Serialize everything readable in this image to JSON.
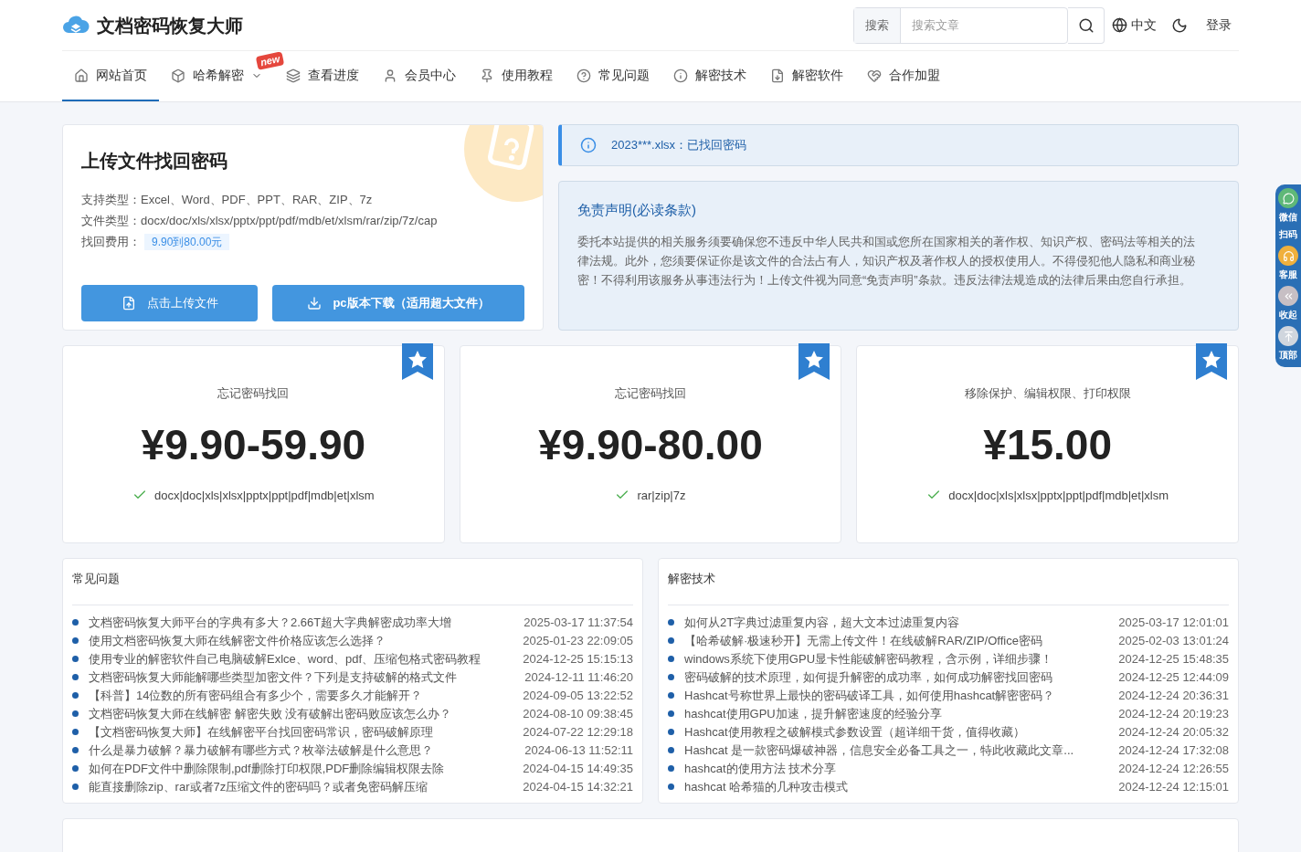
{
  "header": {
    "logo_text": "文档密码恢复大师",
    "search": {
      "button": "搜索",
      "placeholder": "搜索文章"
    },
    "language": "中文",
    "login": "登录"
  },
  "nav": [
    {
      "label": "网站首页",
      "selected": true
    },
    {
      "label": "哈希解密",
      "selected": false,
      "badge": "new",
      "dropdown": true
    },
    {
      "label": "查看进度",
      "selected": false
    },
    {
      "label": "会员中心",
      "selected": false
    },
    {
      "label": "使用教程",
      "selected": false
    },
    {
      "label": "常见问题",
      "selected": false
    },
    {
      "label": "解密技术",
      "selected": false
    },
    {
      "label": "解密软件",
      "selected": false
    },
    {
      "label": "合作加盟",
      "selected": false
    }
  ],
  "upload_card": {
    "title": "上传文件找回密码",
    "rows": [
      {
        "label": "支持类型：",
        "value": "Excel、Word、PDF、PPT、RAR、ZIP、7z"
      },
      {
        "label": "文件类型：",
        "value": "docx/doc/xls/xlsx/pptx/ppt/pdf/mdb/et/xlsm/rar/zip/7z/cap"
      }
    ],
    "fee": {
      "label": "找回费用：",
      "value": "9.90到80.00元"
    },
    "buttons": [
      {
        "label": "点击上传文件"
      },
      {
        "label": "pc版本下载（适用超大文件）"
      }
    ]
  },
  "notice": "2023***.xlsx：已找回密码",
  "disclaimer": {
    "title": "免责声明(必读条款)",
    "body": "委托本站提供的相关服务须要确保您不违反中华人民共和国或您所在国家相关的著作权、知识产权、密码法等相关的法律法规。此外，您须要保证你是该文件的合法占有人，知识产权及著作权人的授权使用人。不得侵犯他人隐私和商业秘密！不得利用该服务从事违法行为！上传文件视为同意“免责声明”条款。违反法律法规造成的法律后果由您自行承担。"
  },
  "price_cards": [
    {
      "subtitle": "忘记密码找回",
      "price": "¥9.90-59.90",
      "formats": "docx|doc|xls|xlsx|pptx|ppt|pdf|mdb|et|xlsm"
    },
    {
      "subtitle": "忘记密码找回",
      "price": "¥9.90-80.00",
      "formats": "rar|zip|7z"
    },
    {
      "subtitle": "移除保护、编辑权限、打印权限",
      "price": "¥15.00",
      "formats": "docx|doc|xls|xlsx|pptx|ppt|pdf|mdb|et|xlsm"
    }
  ],
  "lists": [
    {
      "title": "常见问题",
      "items": [
        {
          "title": "文档密码恢复大师平台的字典有多大？2.66T超大字典解密成功率大增",
          "date": "2025-03-17 11:37:54"
        },
        {
          "title": "使用文档密码恢复大师在线解密文件价格应该怎么选择？",
          "date": "2025-01-23 22:09:05"
        },
        {
          "title": "使用专业的解密软件自己电脑破解Exlce、word、pdf、压缩包格式密码教程",
          "date": "2024-12-25 15:15:13"
        },
        {
          "title": "文档密码恢复大师能解哪些类型加密文件？下列是支持破解的格式文件",
          "date": "2024-12-11 11:46:20"
        },
        {
          "title": "【科普】14位数的所有密码组合有多少个，需要多久才能解开？",
          "date": "2024-09-05 13:22:52"
        },
        {
          "title": "文档密码恢复大师在线解密 解密失败 没有破解出密码败应该怎么办？",
          "date": "2024-08-10 09:38:45"
        },
        {
          "title": "【文档密码恢复大师】在线解密平台找回密码常识，密码破解原理",
          "date": "2024-07-22 12:29:18"
        },
        {
          "title": "什么是暴力破解？暴力破解有哪些方式？枚举法破解是什么意思？",
          "date": "2024-06-13 11:52:11"
        },
        {
          "title": "如何在PDF文件中删除限制,pdf删除打印权限,PDF删除编辑权限去除",
          "date": "2024-04-15 14:49:35"
        },
        {
          "title": "能直接删除zip、rar或者7z压缩文件的密码吗？或者免密码解压缩",
          "date": "2024-04-15 14:32:21"
        }
      ]
    },
    {
      "title": "解密技术",
      "items": [
        {
          "title": "如何从2T字典过滤重复内容，超大文本过滤重复内容",
          "date": "2025-03-17 12:01:01"
        },
        {
          "title": "【哈希破解·极速秒开】无需上传文件！在线破解RAR/ZIP/Office密码",
          "date": "2025-02-03 13:01:24"
        },
        {
          "title": "windows系统下使用GPU显卡性能破解密码教程，含示例，详细步骤！",
          "date": "2024-12-25 15:48:35"
        },
        {
          "title": "密码破解的技术原理，如何提升解密的成功率，如何成功解密找回密码",
          "date": "2024-12-25 12:44:09"
        },
        {
          "title": "Hashcat号称世界上最快的密码破译工具，如何使用hashcat解密密码？",
          "date": "2024-12-24 20:36:31"
        },
        {
          "title": "hashcat使用GPU加速，提升解密速度的经验分享",
          "date": "2024-12-24 20:19:23"
        },
        {
          "title": "Hashcat使用教程之破解模式参数设置（超详细干货，值得收藏）",
          "date": "2024-12-24 20:05:32"
        },
        {
          "title": "Hashcat 是一款密码爆破神器，信息安全必备工具之一，特此收藏此文章...",
          "date": "2024-12-24 17:32:08"
        },
        {
          "title": "hashcat的使用方法 技术分享",
          "date": "2024-12-24 12:26:55"
        },
        {
          "title": "hashcat 哈希猫的几种攻击模式",
          "date": "2024-12-24 12:15:01"
        }
      ]
    }
  ],
  "side_widget": [
    {
      "label": "微信扫码",
      "kind": "wechat"
    },
    {
      "label": "客服",
      "kind": "service"
    },
    {
      "label": "收起",
      "kind": "collapse"
    },
    {
      "label": "顶部",
      "kind": "top"
    }
  ]
}
